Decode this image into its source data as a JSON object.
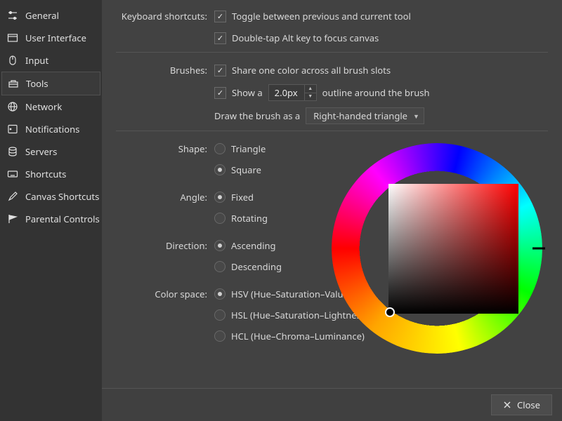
{
  "sidebar": {
    "items": [
      {
        "icon": "sliders-icon",
        "label": "General"
      },
      {
        "icon": "window-icon",
        "label": "User Interface"
      },
      {
        "icon": "mouse-icon",
        "label": "Input"
      },
      {
        "icon": "toolbox-icon",
        "label": "Tools"
      },
      {
        "icon": "network-icon",
        "label": "Network"
      },
      {
        "icon": "bell-icon",
        "label": "Notifications"
      },
      {
        "icon": "servers-icon",
        "label": "Servers"
      },
      {
        "icon": "keyboard-icon",
        "label": "Shortcuts"
      },
      {
        "icon": "brush-icon",
        "label": "Canvas Shortcuts"
      },
      {
        "icon": "flag-icon",
        "label": "Parental Controls"
      }
    ],
    "active_index": 3
  },
  "keyboard_shortcuts": {
    "label": "Keyboard shortcuts:",
    "toggle_prev_tool": {
      "checked": true,
      "text": "Toggle between previous and current tool"
    },
    "double_tap_alt": {
      "checked": true,
      "text": "Double-tap Alt key to focus canvas"
    }
  },
  "brushes": {
    "label": "Brushes:",
    "share_color": {
      "checked": true,
      "text": "Share one color across all brush slots"
    },
    "show_outline": {
      "checked": true,
      "prefix": "Show a",
      "value": "2.0px",
      "suffix": "outline around the brush"
    },
    "draw_as": {
      "prefix": "Draw the brush as a",
      "value": "Right-handed triangle"
    }
  },
  "shape": {
    "label": "Shape:",
    "options": [
      "Triangle",
      "Square"
    ],
    "selected": 1
  },
  "angle": {
    "label": "Angle:",
    "options": [
      "Fixed",
      "Rotating"
    ],
    "selected": 0
  },
  "direction": {
    "label": "Direction:",
    "options": [
      "Ascending",
      "Descending"
    ],
    "selected": 0
  },
  "color_space": {
    "label": "Color space:",
    "options": [
      "HSV (Hue–Saturation–Value)",
      "HSL (Hue–Saturation–Lightness)",
      "HCL (Hue–Chroma–Luminance)"
    ],
    "selected": 0
  },
  "footer": {
    "close": "Close"
  }
}
